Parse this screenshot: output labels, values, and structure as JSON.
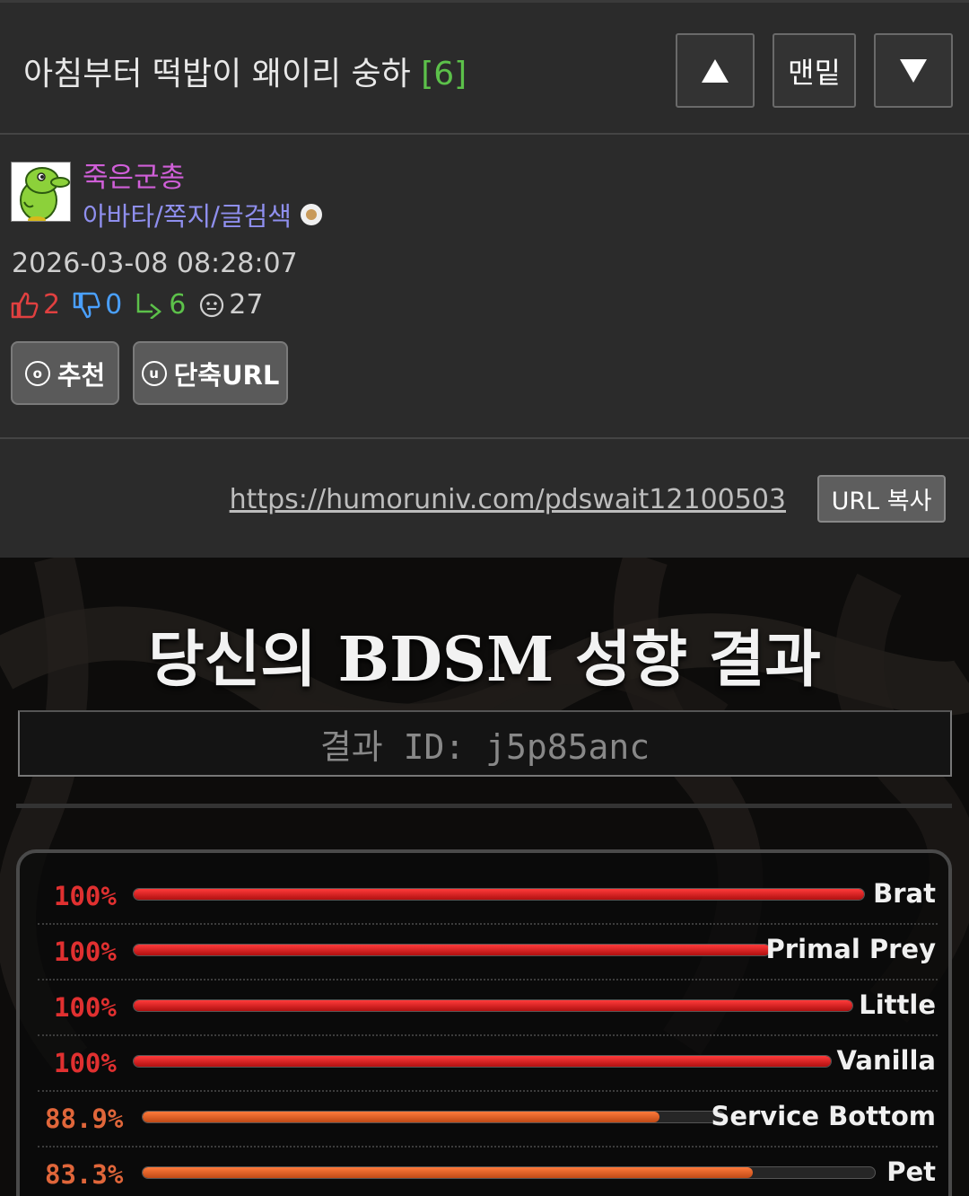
{
  "header": {
    "title": "아침부터 떡밥이 왜이리 숭하",
    "comment_count": "[6]",
    "up_button": "▲",
    "bottom_button": "맨밑",
    "down_button": "▼"
  },
  "author": {
    "nickname": "죽은군총",
    "links": "아바타/쪽지/글검색",
    "date": "2026-03-08 08:28:07",
    "stats": {
      "likes": "2",
      "dislikes": "0",
      "replies": "6",
      "views": "27"
    },
    "recommend_icon": "o",
    "recommend_label": "추천",
    "shorturl_icon": "u",
    "shorturl_label": "단축URL"
  },
  "url_row": {
    "url": "https://humoruniv.com/pdswait12100503",
    "copy_label": "URL 복사"
  },
  "result": {
    "title": "당신의 BDSM 성향 결과",
    "id_label": "결과 ID: j5p85anc",
    "rows": [
      {
        "pct_label": "100%",
        "value": 100,
        "name": "Brat",
        "color": "#e03030"
      },
      {
        "pct_label": "100%",
        "value": 100,
        "name": "Primal Prey",
        "color": "#e03030"
      },
      {
        "pct_label": "100%",
        "value": 100,
        "name": "Little",
        "color": "#e03030"
      },
      {
        "pct_label": "100%",
        "value": 100,
        "name": "Vanilla",
        "color": "#e03030"
      },
      {
        "pct_label": "88.9%",
        "value": 88.9,
        "name": "Service Bottom",
        "color": "#e0663a"
      },
      {
        "pct_label": "83.3%",
        "value": 83.3,
        "name": "Pet",
        "color": "#e0663a"
      }
    ]
  },
  "colors": {
    "accent_green": "#5cc14a",
    "nick_purple": "#d05fd8",
    "link_blue": "#8f8fee",
    "bar_red": "#e03030",
    "bar_orange": "#e0663a"
  }
}
